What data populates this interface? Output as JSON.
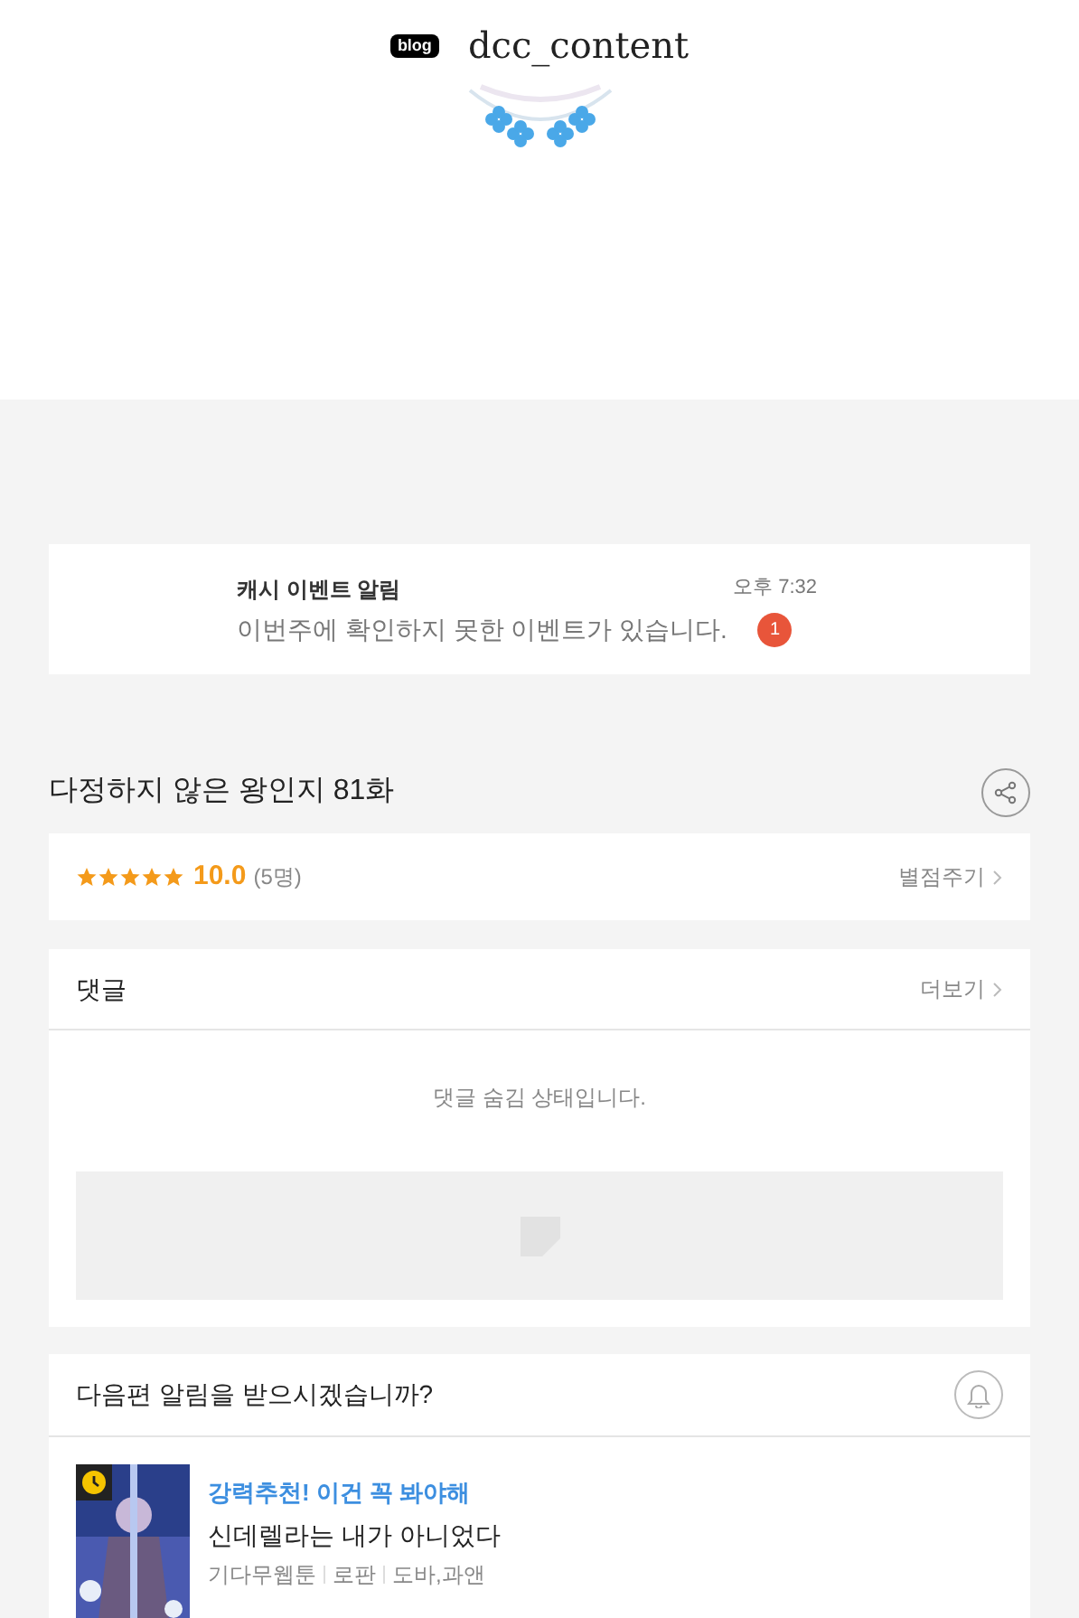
{
  "header": {
    "logo_text": "blog",
    "blog_name": "dcc_content"
  },
  "notice": {
    "title": "캐시 이벤트 알림",
    "message": "이번주에 확인하지 못한 이벤트가 있습니다.",
    "time": "오후 7:32",
    "badge": "1"
  },
  "episode": {
    "title": "다정하지 않은 왕인지 81화"
  },
  "rating": {
    "stars": 5,
    "score": "10.0",
    "count": "(5명)",
    "action": "별점주기"
  },
  "comments": {
    "title": "댓글",
    "more": "더보기",
    "status": "댓글 숨김 상태입니다."
  },
  "subscribe": {
    "question": "다음편 알림을 받으시겠습니까?"
  },
  "recommendation": {
    "tag": "강력추천! 이건 꼭 봐야해",
    "title": "신데렐라는 내가 아니었다",
    "meta": [
      "기다무웹툰",
      "로판",
      "도바,과앤"
    ]
  }
}
